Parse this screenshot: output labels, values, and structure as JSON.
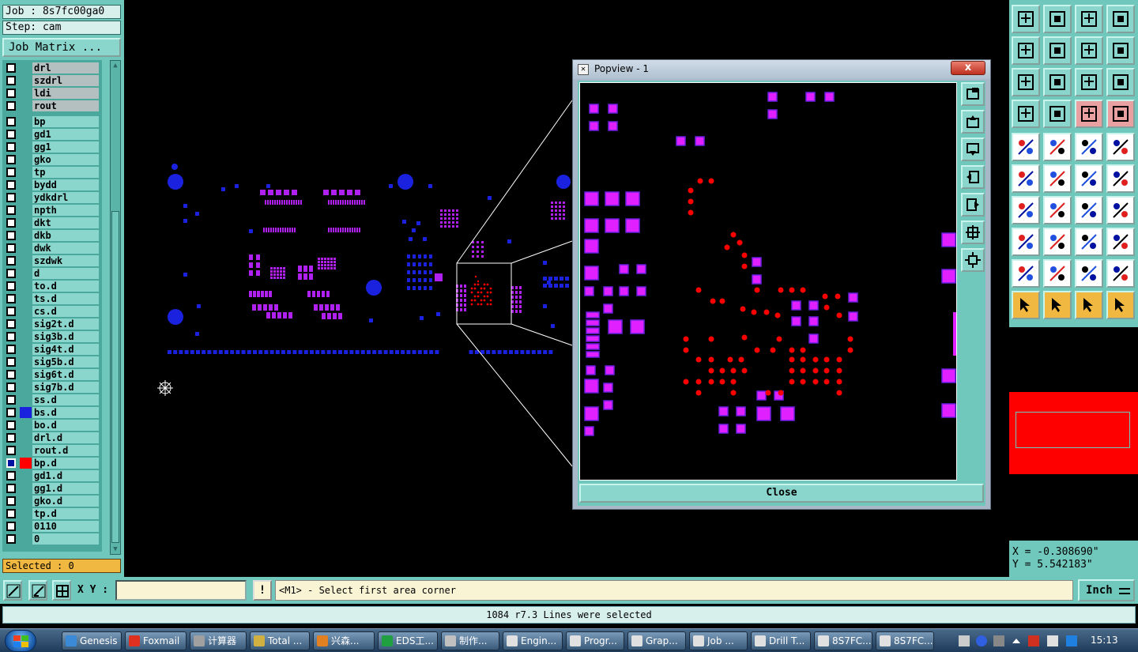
{
  "header": {
    "job": "Job : 8s7fc00ga0",
    "step": "Step: cam",
    "job_matrix": "Job Matrix ..."
  },
  "layers": [
    {
      "name": "drl",
      "style": "grey",
      "swatch": ""
    },
    {
      "name": "szdrl",
      "style": "grey",
      "swatch": ""
    },
    {
      "name": "ldi",
      "style": "grey",
      "swatch": ""
    },
    {
      "name": "rout",
      "style": "grey",
      "swatch": ""
    },
    {
      "name": "bp",
      "style": "",
      "swatch": ""
    },
    {
      "name": "gd1",
      "style": "",
      "swatch": ""
    },
    {
      "name": "gg1",
      "style": "",
      "swatch": ""
    },
    {
      "name": "gko",
      "style": "",
      "swatch": ""
    },
    {
      "name": "tp",
      "style": "",
      "swatch": ""
    },
    {
      "name": "bydd",
      "style": "",
      "swatch": ""
    },
    {
      "name": "ydkdrl",
      "style": "",
      "swatch": ""
    },
    {
      "name": "npth",
      "style": "",
      "swatch": ""
    },
    {
      "name": "dkt",
      "style": "",
      "swatch": ""
    },
    {
      "name": "dkb",
      "style": "",
      "swatch": ""
    },
    {
      "name": "dwk",
      "style": "",
      "swatch": ""
    },
    {
      "name": "szdwk",
      "style": "",
      "swatch": ""
    },
    {
      "name": "d",
      "style": "",
      "swatch": ""
    },
    {
      "name": "to.d",
      "style": "",
      "swatch": ""
    },
    {
      "name": "ts.d",
      "style": "",
      "swatch": ""
    },
    {
      "name": "cs.d",
      "style": "",
      "swatch": ""
    },
    {
      "name": "sig2t.d",
      "style": "",
      "swatch": ""
    },
    {
      "name": "sig3b.d",
      "style": "",
      "swatch": ""
    },
    {
      "name": "sig4t.d",
      "style": "",
      "swatch": ""
    },
    {
      "name": "sig5b.d",
      "style": "",
      "swatch": ""
    },
    {
      "name": "sig6t.d",
      "style": "",
      "swatch": ""
    },
    {
      "name": "sig7b.d",
      "style": "",
      "swatch": ""
    },
    {
      "name": "ss.d",
      "style": "",
      "swatch": ""
    },
    {
      "name": "bs.d",
      "style": "",
      "swatch": "#1a22e0"
    },
    {
      "name": "bo.d",
      "style": "",
      "swatch": ""
    },
    {
      "name": "drl.d",
      "style": "",
      "swatch": ""
    },
    {
      "name": "rout.d",
      "style": "",
      "swatch": ""
    },
    {
      "name": "bp.d",
      "style": "sel",
      "swatch": "#ff0000"
    },
    {
      "name": "gd1.d",
      "style": "",
      "swatch": ""
    },
    {
      "name": "gg1.d",
      "style": "",
      "swatch": ""
    },
    {
      "name": "gko.d",
      "style": "",
      "swatch": ""
    },
    {
      "name": "tp.d",
      "style": "",
      "swatch": ""
    },
    {
      "name": "0110",
      "style": "",
      "swatch": ""
    },
    {
      "name": "0",
      "style": "",
      "swatch": ""
    }
  ],
  "selected": "Selected : 0",
  "popview": {
    "title": "Popview - 1",
    "close_x": "x",
    "close_button": "Close"
  },
  "coords": {
    "x": "X = -0.308690\"",
    "y": "Y = 5.542183\""
  },
  "command": {
    "xy_label": "X Y :",
    "xy_value": "",
    "excl": "!",
    "prompt": "<M1> - Select first area corner",
    "units": "Inch"
  },
  "status": "1084 r7.3 Lines were selected",
  "taskbar": {
    "items": [
      {
        "label": "Genesis",
        "color": "#3a8ad8"
      },
      {
        "label": "Foxmail",
        "color": "#e03020"
      },
      {
        "label": "计算器",
        "color": "#a0a0a0"
      },
      {
        "label": "Total ...",
        "color": "#d0b040"
      },
      {
        "label": "兴森...",
        "color": "#e08020"
      },
      {
        "label": "EDS工...",
        "color": "#20a040"
      },
      {
        "label": "制作...",
        "color": "#c0c0c0"
      },
      {
        "label": "Engin...",
        "color": "#e0e0e0"
      },
      {
        "label": "Progr...",
        "color": "#e0e0e0"
      },
      {
        "label": "Grap...",
        "color": "#e0e0e0"
      },
      {
        "label": "Job ...",
        "color": "#e0e0e0"
      },
      {
        "label": "Drill T...",
        "color": "#e0e0e0"
      },
      {
        "label": "8S7FC...",
        "color": "#e0e0e0"
      },
      {
        "label": "8S7FC...",
        "color": "#e0e0e0"
      }
    ],
    "clock": "15:13"
  },
  "colors": {
    "panel": "#70c8bc",
    "board_blue": "#1a22e0",
    "board_magenta": "#b020f0",
    "highlight_red": "#ff0000",
    "pad_magenta": "#e020ff"
  }
}
